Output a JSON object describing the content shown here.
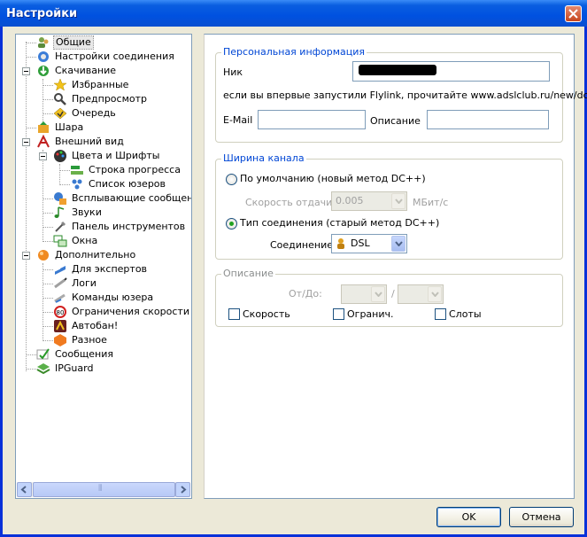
{
  "window": {
    "title": "Настройки"
  },
  "tree": {
    "items": [
      {
        "label": "Общие",
        "icon": "people-icon",
        "selected": true
      },
      {
        "label": "Настройки соединения",
        "icon": "network-icon"
      },
      {
        "label": "Скачивание",
        "icon": "download-icon"
      },
      {
        "label": "Избранные",
        "icon": "star-icon"
      },
      {
        "label": "Предпросмотр",
        "icon": "preview-icon"
      },
      {
        "label": "Очередь",
        "icon": "queue-icon"
      },
      {
        "label": "Шара",
        "icon": "share-icon"
      },
      {
        "label": "Внешний вид",
        "icon": "appearance-icon"
      },
      {
        "label": "Цвета и Шрифты",
        "icon": "palette-icon"
      },
      {
        "label": "Строка прогресса",
        "icon": "progress-icon"
      },
      {
        "label": "Список юзеров",
        "icon": "users-icon"
      },
      {
        "label": "Всплывающие сообщения",
        "icon": "popup-icon"
      },
      {
        "label": "Звуки",
        "icon": "sound-icon"
      },
      {
        "label": "Панель инструментов",
        "icon": "toolbar-icon"
      },
      {
        "label": "Окна",
        "icon": "windows-icon"
      },
      {
        "label": "Дополнительно",
        "icon": "advanced-icon"
      },
      {
        "label": "Для экспертов",
        "icon": "expert-icon"
      },
      {
        "label": "Логи",
        "icon": "logs-icon"
      },
      {
        "label": "Команды юзера",
        "icon": "commands-icon"
      },
      {
        "label": "Ограничения скорости",
        "icon": "speed-limit-icon"
      },
      {
        "label": "Автобан!",
        "icon": "autoban-icon"
      },
      {
        "label": "Разное",
        "icon": "misc-icon"
      },
      {
        "label": "Сообщения",
        "icon": "messages-icon"
      },
      {
        "label": "IPGuard",
        "icon": "ipguard-icon"
      }
    ],
    "scroll_grip": "⦀"
  },
  "personal": {
    "title": "Персональная информация",
    "nick_label": "Ник",
    "nick_value": "",
    "hint": "если вы впервые запустили Flylink, прочитайте www.adslclub.ru/new/dc",
    "email_label": "E-Mail",
    "email_value": "",
    "desc_label": "Описание",
    "desc_value": ""
  },
  "bandwidth": {
    "title": "Ширина канала",
    "default_radio": "По умолчанию (новый метод DC++)",
    "upload_label": "Скорость отдачи",
    "upload_value": "0.005",
    "upload_unit": "МБит/с",
    "type_radio": "Тип соединения (старый метод DC++)",
    "connection_label": "Соединение",
    "connection_value": "DSL",
    "selected": "type"
  },
  "description": {
    "title": "Описание",
    "from_to_label": "От/До:",
    "separator": "/",
    "from_value": "",
    "to_value": "",
    "check_speed": "Скорость",
    "check_limit": "Огранич.",
    "check_slots": "Слоты"
  },
  "buttons": {
    "ok": "OK",
    "cancel": "Отмена"
  },
  "colors": {
    "title_bar": "#0054e3",
    "group_title": "#0046d5",
    "selection": "#e8e8e8"
  }
}
